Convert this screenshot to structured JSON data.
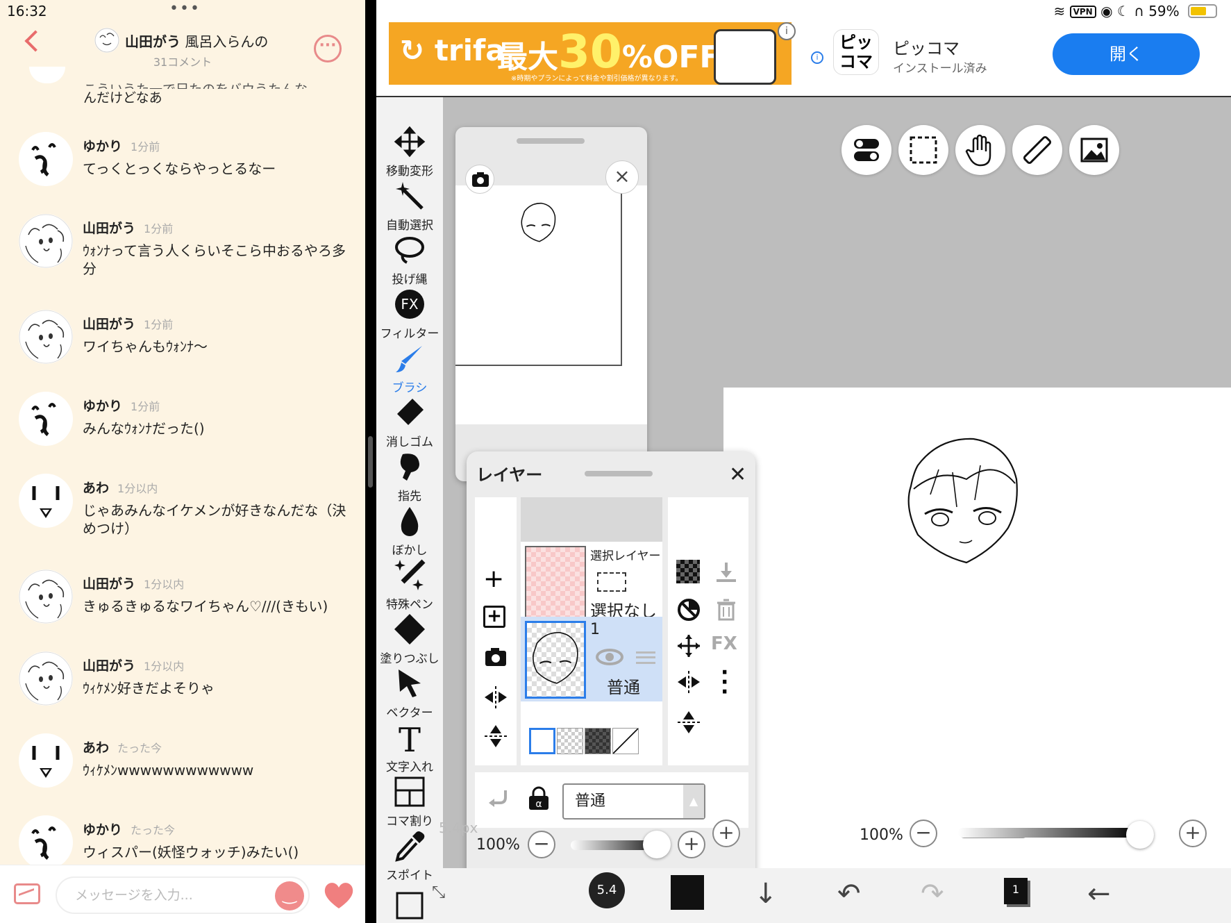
{
  "chat": {
    "status_time": "16:32",
    "status_dots": "•••",
    "header": {
      "author": "山田がう",
      "topic": "風呂入らんの",
      "comment_count": "31コメント"
    },
    "partial_message": {
      "top_line": "こういうた一で兄たのをバウうたんな",
      "text": "んだけどなあ"
    },
    "messages": [
      {
        "user": "ゆかり",
        "time": "1分前",
        "text": "てっくとっくならやっとるなー",
        "avatar": "yukari"
      },
      {
        "user": "山田がう",
        "time": "1分前",
        "text": "ｳｫﾝﾅって言う人くらいそこら中おるやろ多分",
        "avatar": "yamada"
      },
      {
        "user": "山田がう",
        "time": "1分前",
        "text": "ワイちゃんもｳｫﾝﾅ〜",
        "avatar": "yamada"
      },
      {
        "user": "ゆかり",
        "time": "1分前",
        "text": "みんなｳｫﾝﾅだった()",
        "avatar": "yukari"
      },
      {
        "user": "あわ",
        "time": "1分以内",
        "text": "じゃあみんなイケメンが好きなんだな（決めつけ）",
        "avatar": "awa"
      },
      {
        "user": "山田がう",
        "time": "1分以内",
        "text": "きゅるきゅるなワイちゃん♡///(きもい)",
        "avatar": "yamada"
      },
      {
        "user": "山田がう",
        "time": "1分以内",
        "text": "ｳｨｹﾒﾝ好きだよそりゃ",
        "avatar": "yamada"
      },
      {
        "user": "あわ",
        "time": "たった今",
        "text": "ｳｨｹﾒﾝwwwwwwwwwwww",
        "avatar": "awa"
      },
      {
        "user": "ゆかり",
        "time": "たった今",
        "text": "ウィスパー(妖怪ウォッチ)みたい()",
        "avatar": "yukari"
      }
    ],
    "compose_placeholder": "メッセージを入力...",
    "icons": {
      "back": "chevron-left-icon",
      "more": "more-icon",
      "image": "image-icon",
      "emoji": "smile-icon",
      "like": "heart-icon"
    },
    "accent_color": "#e88a8a"
  },
  "app": {
    "status": {
      "battery": "59%",
      "vpn": "VPN"
    },
    "ads": {
      "trifa": {
        "brand": "trifa",
        "prefix": "最大",
        "discount": "30",
        "unit": "%OFF",
        "note": "※時期やプランによって料金や割引価格が異なります。"
      },
      "pickoma": {
        "name": "ピッコマ",
        "status": "インストール済み",
        "open_label": "開く",
        "icon_text": "ピッ コマ"
      }
    },
    "tools": [
      {
        "label": "移動変形",
        "icon": "move-icon"
      },
      {
        "label": "自動選択",
        "icon": "magic-wand-icon"
      },
      {
        "label": "投げ縄",
        "icon": "lasso-icon"
      },
      {
        "label": "フィルター",
        "icon": "fx-icon"
      },
      {
        "label": "ブラシ",
        "icon": "brush-icon",
        "active": true
      },
      {
        "label": "消しゴム",
        "icon": "eraser-icon"
      },
      {
        "label": "指先",
        "icon": "finger-icon"
      },
      {
        "label": "ぼかし",
        "icon": "blur-icon"
      },
      {
        "label": "特殊ペン",
        "icon": "special-pen-icon"
      },
      {
        "label": "塗りつぶし",
        "icon": "fill-icon"
      },
      {
        "label": "ベクター",
        "icon": "vector-icon"
      },
      {
        "label": "文字入れ",
        "icon": "text-icon"
      },
      {
        "label": "コマ割り",
        "icon": "frame-divider-icon"
      },
      {
        "label": "スポイト",
        "icon": "eyedropper-icon"
      }
    ],
    "layer_panel": {
      "title": "レイヤー",
      "selection_layer": {
        "name": "選択レイヤー",
        "state": "選択なし"
      },
      "layer1": {
        "name": "1",
        "mode": "普通"
      },
      "blend_mode": "普通",
      "opacity": "100%",
      "opacity_value": 1.0,
      "fx_label": "FX"
    },
    "canvas": {
      "zoom": "100%",
      "brush_size": "5.4",
      "brush_size_px": "5.4px",
      "page_count": "1"
    },
    "accent_color": "#2b7de9"
  }
}
